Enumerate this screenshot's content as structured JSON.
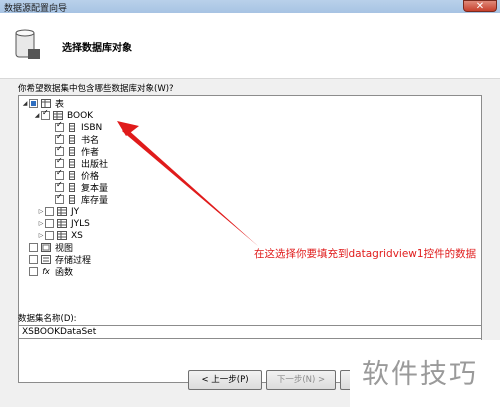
{
  "window": {
    "title": "数据源配置向导",
    "close_symbol": "✕"
  },
  "header": {
    "title": "选择数据库对象"
  },
  "prompt": "你希望数据集中包含哪些数据库对象(W)?",
  "tree": {
    "root_label": "表",
    "book": {
      "label": "BOOK",
      "columns": [
        "ISBN",
        "书名",
        "作者",
        "出版社",
        "价格",
        "复本量",
        "库存量"
      ]
    },
    "other_tables": [
      "JY",
      "JYLS",
      "XS"
    ],
    "views_label": "视图",
    "procs_label": "存储过程",
    "funcs_label": "函数",
    "funcs_icon_text": "fx"
  },
  "dataset": {
    "label": "数据集名称(D):",
    "value": "XSBOOKDataSet"
  },
  "buttons": {
    "prev": "< 上一步(P)",
    "next": "下一步(N) >"
  },
  "annotation": {
    "text": "在这选择你要填充到datagridview1控件的数据",
    "color": "#e01b1b"
  },
  "watermark": "软件技巧"
}
